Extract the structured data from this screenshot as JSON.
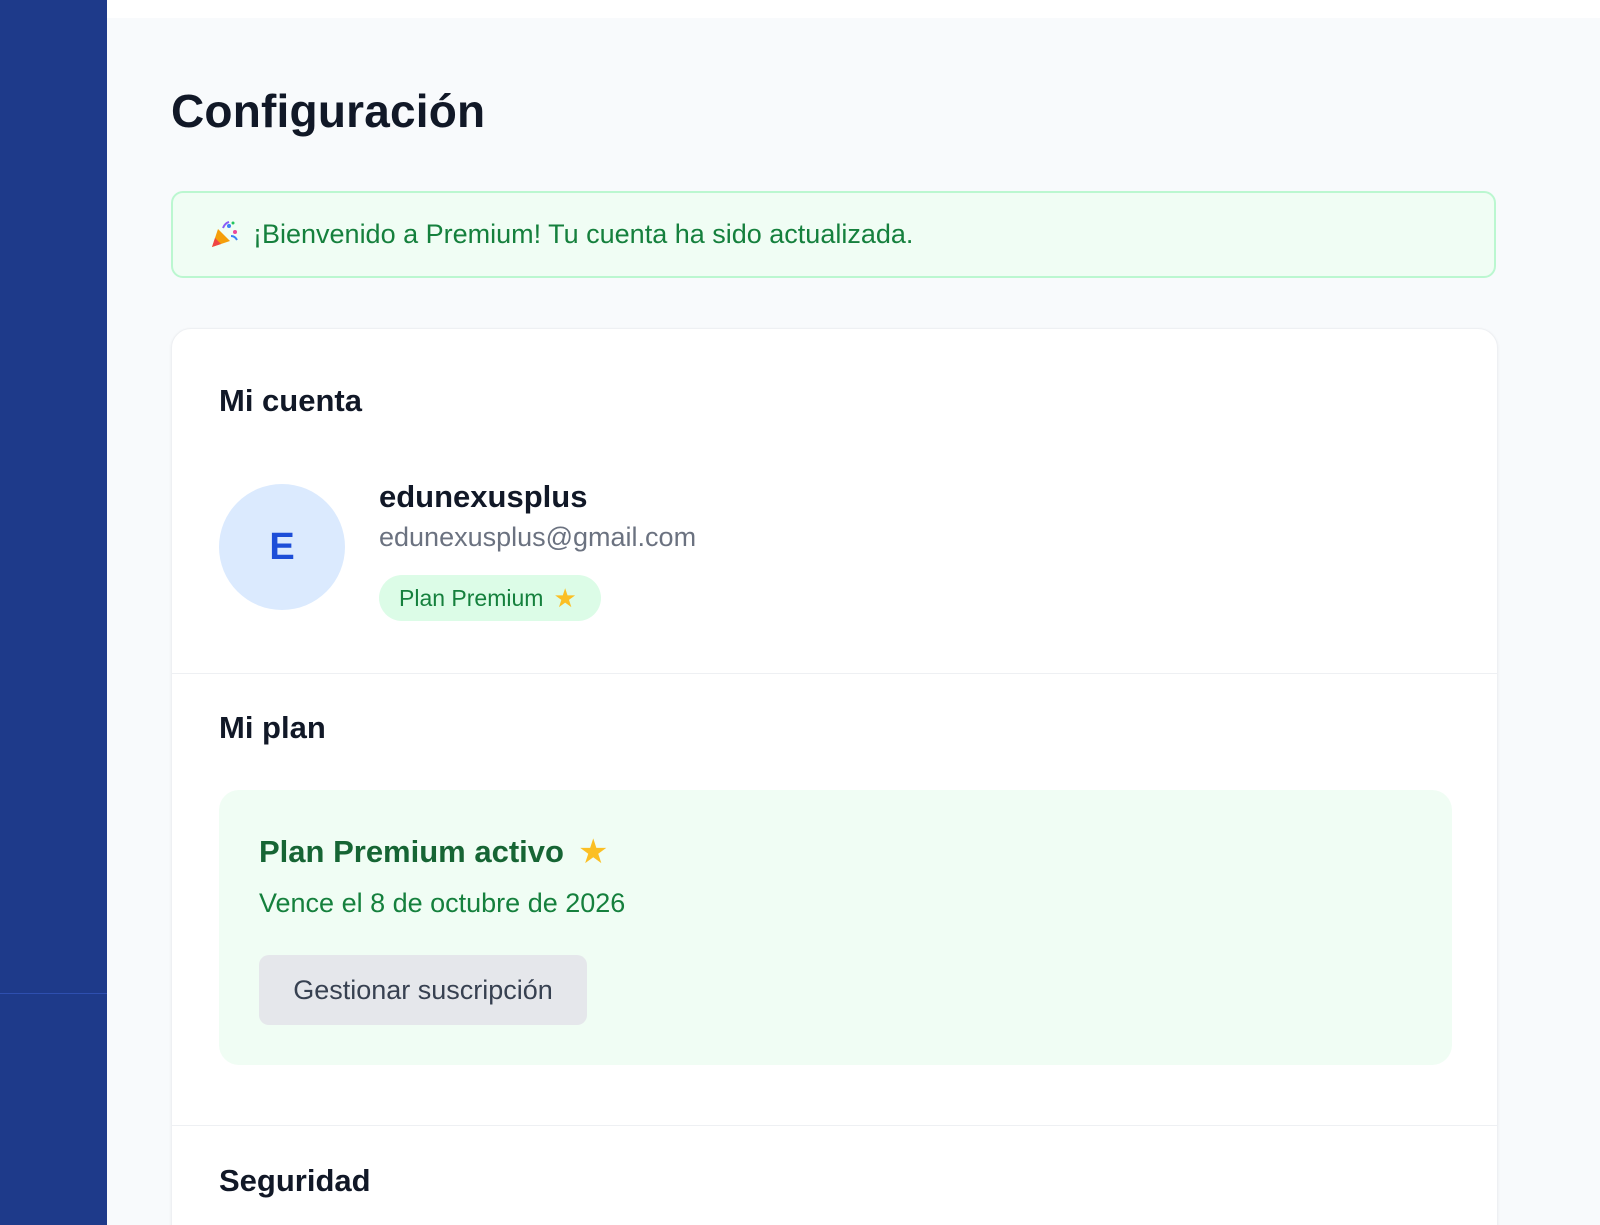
{
  "page": {
    "title": "Configuración"
  },
  "alert": {
    "icon": "party-popper-icon",
    "message": "¡Bienvenido a Premium! Tu cuenta ha sido actualizada."
  },
  "account": {
    "section_title": "Mi cuenta",
    "avatar_initial": "E",
    "username": "edunexusplus",
    "email": "edunexusplus@gmail.com",
    "plan_badge": "Plan Premium",
    "plan_badge_icon": "star-icon"
  },
  "plan": {
    "section_title": "Mi plan",
    "status": "Plan Premium activo",
    "status_icon": "star-icon",
    "expiry": "Vence el 8 de octubre de 2026",
    "manage_label": "Gestionar suscripción"
  },
  "security": {
    "section_title": "Seguridad"
  },
  "colors": {
    "sidebar": "#1e3a8a",
    "success_bg": "#f0fdf4",
    "success_text": "#15803d",
    "avatar_bg": "#dbeafe",
    "avatar_text": "#1d4ed8",
    "star": "#fbbf24"
  }
}
